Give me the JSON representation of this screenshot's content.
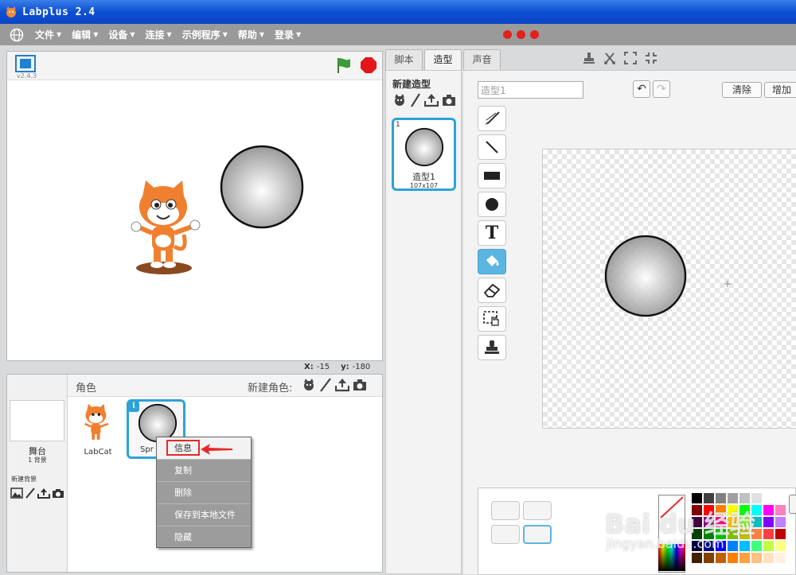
{
  "window": {
    "title": "Labplus 2.4"
  },
  "menu": {
    "items": [
      {
        "label": "文件"
      },
      {
        "label": "编辑"
      },
      {
        "label": "设备"
      },
      {
        "label": "连接"
      },
      {
        "label": "示例程序"
      },
      {
        "label": "帮助"
      },
      {
        "label": "登录"
      }
    ],
    "caret": "▼"
  },
  "stage": {
    "version": "v2.4.3",
    "x_label": "X:",
    "x_value": "-15",
    "y_label": "y:",
    "y_value": "-180"
  },
  "sprites": {
    "title": "角色",
    "new_sprite_label": "新建角色:",
    "stage_label": "舞台",
    "bg_count": "1 背景",
    "new_bg_label": "新建背景",
    "items": [
      {
        "name": "LabCat"
      },
      {
        "name": "Spr"
      }
    ],
    "info_badge": "i"
  },
  "context_menu": {
    "items": [
      "信息",
      "复制",
      "删除",
      "保存到本地文件",
      "隐藏"
    ]
  },
  "tabs": [
    "脚本",
    "造型",
    "声音"
  ],
  "costumes": {
    "new_label": "新建造型",
    "items": [
      {
        "index": "1",
        "name": "造型1",
        "size": "107x107"
      }
    ]
  },
  "paint": {
    "name_value": "造型1",
    "clear_label": "清除",
    "add_label": "增加",
    "undo": "↶",
    "redo": "↷",
    "text_tool": "T",
    "crosshair": "+"
  },
  "palette_colors": [
    "#000000",
    "#404040",
    "#808080",
    "#a0a0a0",
    "#c0c0c0",
    "#e0e0e0",
    "#ffffff",
    "#ffffff",
    "#800000",
    "#ff0000",
    "#ff8000",
    "#ffff00",
    "#00ff00",
    "#00ffff",
    "#ff00ff",
    "#ff80c0",
    "#400040",
    "#800080",
    "#ff0080",
    "#ffc000",
    "#80ff00",
    "#00c0c0",
    "#8000ff",
    "#c080ff",
    "#004000",
    "#008000",
    "#00c000",
    "#80c000",
    "#c0c000",
    "#ff8040",
    "#ff4040",
    "#c00000",
    "#000040",
    "#000080",
    "#0000ff",
    "#0080ff",
    "#00c0ff",
    "#40ff80",
    "#c0ff40",
    "#ffff80",
    "#402000",
    "#804000",
    "#c06000",
    "#ff8000",
    "#ffa040",
    "#ffc080",
    "#ffe0c0",
    "#fff0e0"
  ],
  "watermark": {
    "main": "Bai du 经验",
    "sub": "jingyan.baidu.com"
  }
}
